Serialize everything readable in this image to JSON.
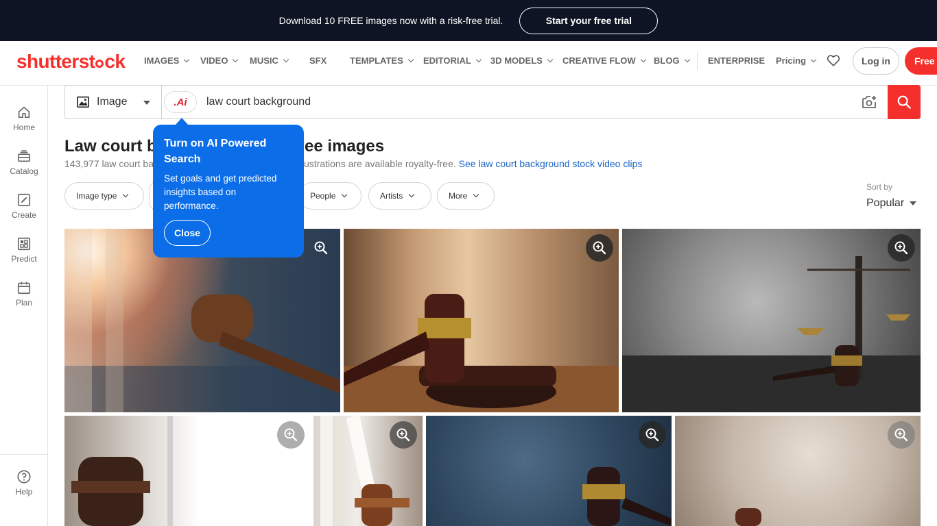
{
  "promo": {
    "text": "Download 10 FREE images now with a risk-free trial.",
    "cta": "Start your free trial"
  },
  "brand": {
    "name_part1": "shutterst",
    "name_part2": "ck"
  },
  "nav": {
    "items": [
      "IMAGES",
      "VIDEO",
      "MUSIC",
      "SFX",
      "TEMPLATES",
      "EDITORIAL",
      "3D MODELS",
      "CREATIVE FLOW",
      "BLOG",
      "ENTERPRISE",
      "Pricing"
    ],
    "login": "Log in",
    "free": "Free t"
  },
  "rail": {
    "home": "Home",
    "catalog": "Catalog",
    "create": "Create",
    "predict": "Predict",
    "plan": "Plan",
    "help": "Help"
  },
  "search": {
    "type": "Image",
    "ai_label": ".Ai",
    "query": "law court background"
  },
  "heading": {
    "title_left": "Law court ba",
    "title_right": "ee images",
    "subtitle_left": "143,977 law court ba",
    "subtitle_right": "d illustrations are available royalty-free.",
    "video_link": "See law court background stock video clips"
  },
  "filters": {
    "image_type": "Image type",
    "people": "People",
    "artists": "Artists",
    "more": "More"
  },
  "sort": {
    "label": "Sort by",
    "value": "Popular"
  },
  "tooltip": {
    "title": "Turn on AI Powered Search",
    "body": "Set goals and get predicted insights based on performance.",
    "close": "Close"
  },
  "colors": {
    "brand": "#f5302c",
    "tooltip": "#0b6ee8",
    "link": "#1663c7",
    "banner": "#0e1423"
  }
}
